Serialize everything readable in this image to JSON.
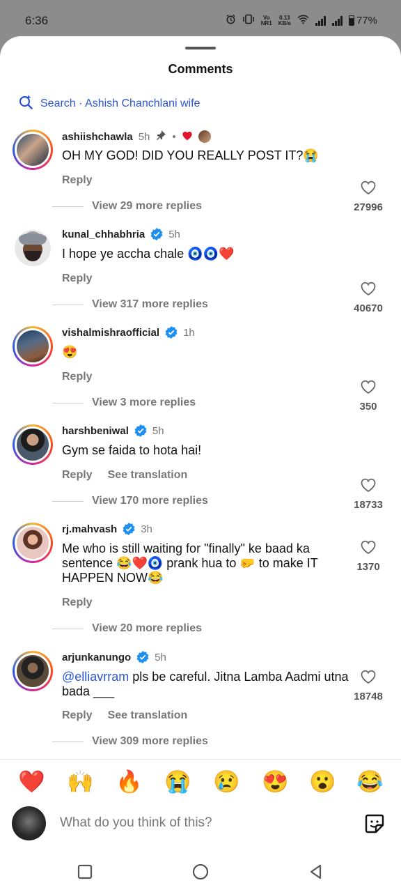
{
  "status": {
    "time": "6:36",
    "speed_value": "0.13",
    "speed_unit": "KB/s",
    "volte": "Vo",
    "volte2": "NR1",
    "battery": "77%"
  },
  "sheet": {
    "title": "Comments",
    "search": "Search · Ashish Chanchlani wife"
  },
  "comments": [
    {
      "user": "ashiishchawla",
      "time": "5h",
      "verified": false,
      "pinned": true,
      "text": "OH MY GOD! DID YOU REALLY POST IT?😭",
      "reply": "Reply",
      "translate": "",
      "more": "View 29 more replies",
      "likes": "27996"
    },
    {
      "user": "kunal_chhabhria",
      "time": "5h",
      "verified": true,
      "text": "I hope ye accha chale 🧿🧿❤️",
      "reply": "Reply",
      "translate": "",
      "more": "View 317 more replies",
      "likes": "40670"
    },
    {
      "user": "vishalmishraofficial",
      "time": "1h",
      "verified": true,
      "text": "😍",
      "reply": "Reply",
      "translate": "",
      "more": "View 3 more replies",
      "likes": "350"
    },
    {
      "user": "harshbeniwal",
      "time": "5h",
      "verified": true,
      "text": "Gym se faida to hota hai!",
      "reply": "Reply",
      "translate": "See translation",
      "more": "View 170 more replies",
      "likes": "18733"
    },
    {
      "user": "rj.mahvash",
      "time": "3h",
      "verified": true,
      "text": "Me who is still waiting for \"finally\" ke baad ka sentence 😂❤️🧿 prank hua to 🤛 to make IT HAPPEN NOW😂",
      "reply": "Reply",
      "translate": "",
      "more": "View 20 more replies",
      "likes": "1370"
    },
    {
      "user": "arjunkanungo",
      "time": "5h",
      "verified": true,
      "mention": "@elliavrram",
      "text": " pls be careful. Jitna Lamba Aadmi utna bada ___",
      "reply": "Reply",
      "translate": "See translation",
      "more": "View 309 more replies",
      "likes": "18748"
    }
  ],
  "emojis": [
    "❤️",
    "🙌",
    "🔥",
    "😭",
    "😢",
    "😍",
    "😮",
    "😂"
  ],
  "input": {
    "placeholder": "What do you think of this?"
  }
}
